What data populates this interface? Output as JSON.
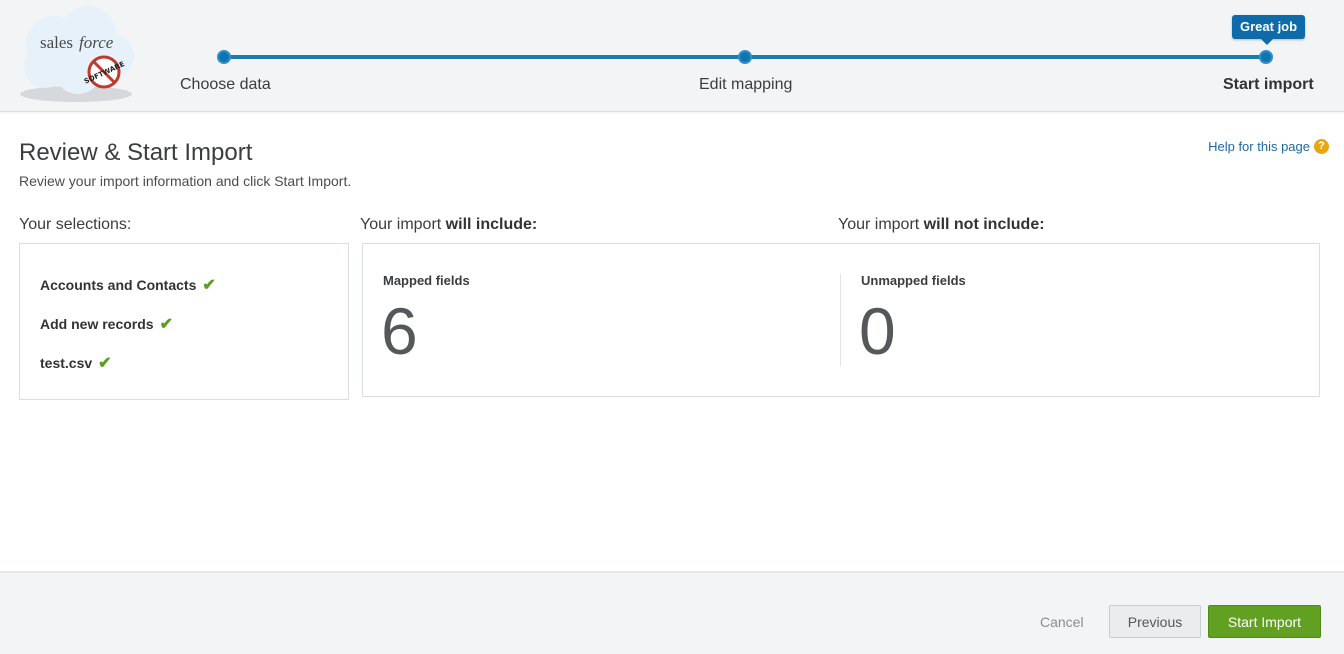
{
  "header": {
    "logo": {
      "text_sales": "sales",
      "text_force": "force",
      "badge_text": "SOFTWARE"
    },
    "steps": [
      {
        "label": "Choose data",
        "state": "complete"
      },
      {
        "label": "Edit mapping",
        "state": "complete"
      },
      {
        "label": "Start import",
        "state": "current"
      }
    ],
    "tooltip": "Great job"
  },
  "main": {
    "title": "Review & Start Import",
    "subtitle": "Review your import information and click Start Import.",
    "help_link": "Help for this page",
    "help_icon": "question-icon",
    "selections": {
      "heading": "Your selections:",
      "items": [
        "Accounts and Contacts",
        "Add new records",
        "test.csv"
      ],
      "check_glyph": "✔"
    },
    "include": {
      "heading_prefix": "Your import ",
      "heading_bold": "will include:",
      "label": "Mapped fields",
      "value": "6"
    },
    "exclude": {
      "heading_prefix": "Your import ",
      "heading_bold": "will not include:",
      "label": "Unmapped fields",
      "value": "0"
    }
  },
  "footer": {
    "cancel_label": "Cancel",
    "previous_label": "Previous",
    "start_label": "Start Import"
  },
  "colors": {
    "accent_blue": "#0f74b2",
    "start_green": "#62a022",
    "check_green": "#5a9e1c"
  }
}
